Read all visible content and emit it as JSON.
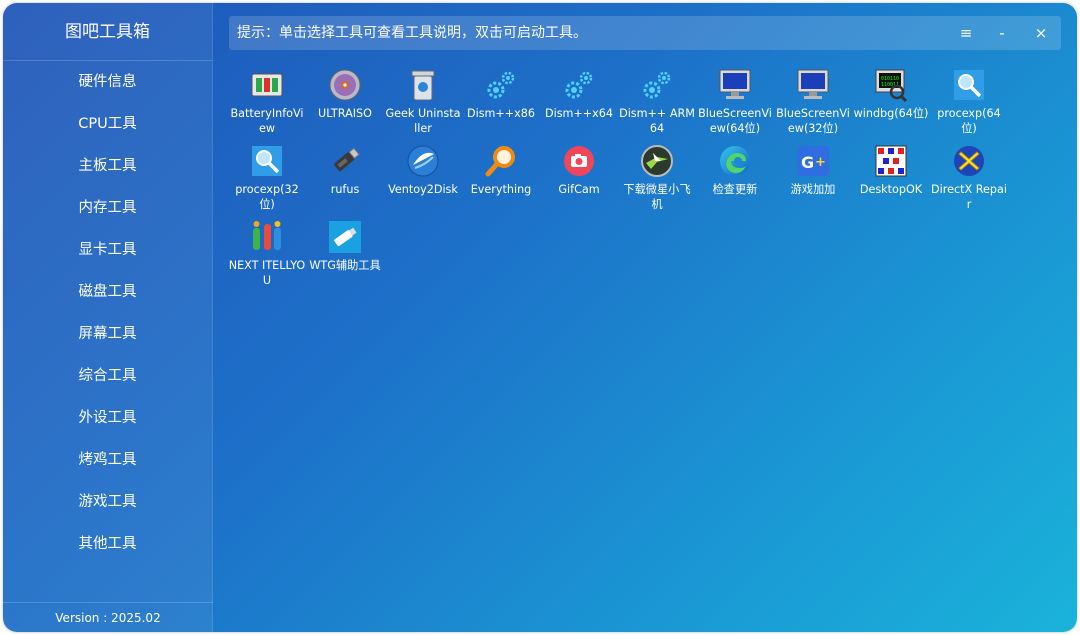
{
  "app": {
    "title": "图吧工具箱",
    "version": "Version : 2025.02"
  },
  "hint": "提示：单击选择工具可查看工具说明，双击可启动工具。",
  "window_controls": {
    "menu": "≡",
    "minimize": "-",
    "close": "×"
  },
  "sidebar": {
    "items": [
      "硬件信息",
      "CPU工具",
      "主板工具",
      "内存工具",
      "显卡工具",
      "磁盘工具",
      "屏幕工具",
      "综合工具",
      "外设工具",
      "烤鸡工具",
      "游戏工具",
      "其他工具"
    ]
  },
  "tools": [
    {
      "label": "BatteryInfoView",
      "icon": "battery-icon"
    },
    {
      "label": "ULTRAISO",
      "icon": "disc-icon"
    },
    {
      "label": "Geek Uninstaller",
      "icon": "trash-can-icon"
    },
    {
      "label": "Dism++x86",
      "icon": "gears-icon"
    },
    {
      "label": "Dism++x64",
      "icon": "gears-icon"
    },
    {
      "label": "Dism++ ARM64",
      "icon": "gears-icon"
    },
    {
      "label": "BlueScreenView(64位)",
      "icon": "monitor-icon"
    },
    {
      "label": "BlueScreenView(32位)",
      "icon": "monitor-icon"
    },
    {
      "label": "windbg(64位)",
      "icon": "debug-monitor-icon"
    },
    {
      "label": "procexp(64位)",
      "icon": "magnifier-window-icon"
    },
    {
      "label": "procexp(32位)",
      "icon": "magnifier-window-icon"
    },
    {
      "label": "rufus",
      "icon": "usb-drive-icon"
    },
    {
      "label": "Ventoy2Disk",
      "icon": "ventoy-icon"
    },
    {
      "label": "Everything",
      "icon": "search-icon"
    },
    {
      "label": "GifCam",
      "icon": "camera-icon"
    },
    {
      "label": "下载微星小飞机",
      "icon": "afterburner-icon"
    },
    {
      "label": "检查更新",
      "icon": "edge-icon"
    },
    {
      "label": "游戏加加",
      "icon": "gameplus-icon"
    },
    {
      "label": "DesktopOK",
      "icon": "grid-icon"
    },
    {
      "label": "DirectX Repair",
      "icon": "directx-icon"
    },
    {
      "label": "NEXT ITELLYOU",
      "icon": "itellyou-icon"
    },
    {
      "label": "WTG辅助工具",
      "icon": "wtg-icon"
    }
  ]
}
